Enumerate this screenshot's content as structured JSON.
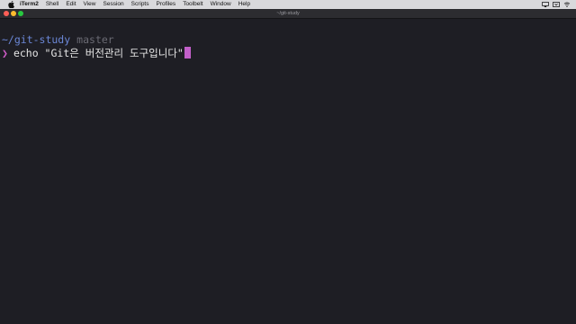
{
  "menubar": {
    "items": [
      "iTerm2",
      "Shell",
      "Edit",
      "View",
      "Session",
      "Scripts",
      "Profiles",
      "Toolbelt",
      "Window",
      "Help"
    ],
    "icons": [
      "apple-icon",
      "airplay-icon",
      "dropbox-icon",
      "wifi-icon"
    ]
  },
  "window": {
    "title": "~/git-study"
  },
  "terminal": {
    "path": "~/git-study",
    "branch": "master",
    "prompt_symbol": "❯",
    "command": "echo \"Git은 버전관리 도구입니다\""
  },
  "colors": {
    "background": "#1e1e24",
    "path": "#6b87d6",
    "branch": "#6a6a73",
    "prompt": "#cf5cc7",
    "cursor": "#c25fc9"
  }
}
